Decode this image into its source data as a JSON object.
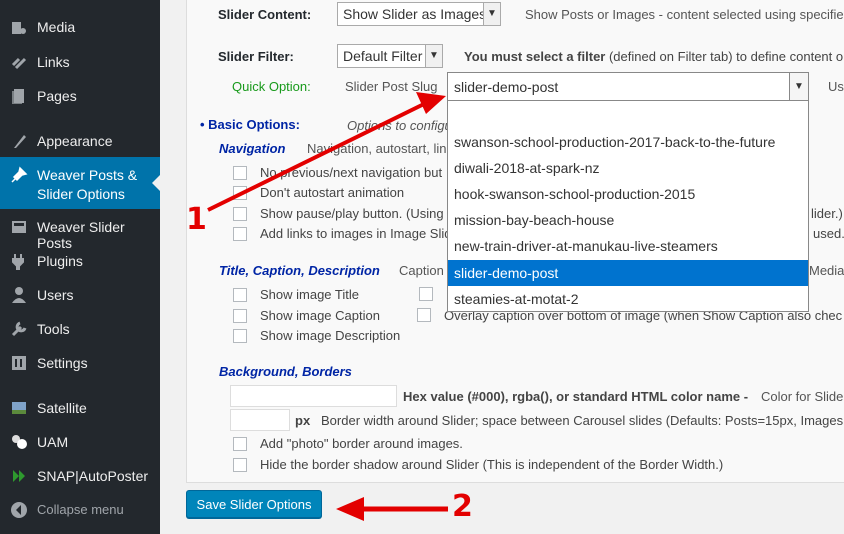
{
  "sidebar": {
    "items": [
      {
        "label": "Media",
        "icon": "media-icon"
      },
      {
        "label": "Links",
        "icon": "links-icon"
      },
      {
        "label": "Pages",
        "icon": "pages-icon"
      },
      {
        "label": "Appearance",
        "icon": "appearance-icon"
      },
      {
        "label": "Weaver Posts & Slider Options",
        "label_line1": "Weaver Posts &",
        "label_line2": "Slider Options",
        "icon": "pin-icon",
        "active": true
      },
      {
        "label": "Weaver Slider Posts",
        "icon": "weaver-slider-posts-icon"
      },
      {
        "label": "Plugins",
        "icon": "plugins-icon"
      },
      {
        "label": "Users",
        "icon": "users-icon"
      },
      {
        "label": "Tools",
        "icon": "tools-icon"
      },
      {
        "label": "Settings",
        "icon": "settings-icon"
      },
      {
        "label": "Satellite",
        "icon": "satellite-icon"
      },
      {
        "label": "UAM",
        "icon": "uam-icon"
      },
      {
        "label": "SNAP|AutoPoster",
        "icon": "snap-icon"
      }
    ],
    "collapse_label": "Collapse menu"
  },
  "form": {
    "slider_content": {
      "label": "Slider Content:",
      "value": "Show Slider as Images",
      "desc": "Show Posts or Images - content selected using specifie"
    },
    "slider_filter": {
      "label": "Slider Filter:",
      "value": "Default Filter",
      "desc_bold": "You must select a filter",
      "desc_rest": " (defined on Filter tab) to define content o"
    },
    "quick_option": {
      "label": "Quick Option:",
      "slug_label": "Slider Post Slug",
      "value": "slider-demo-post",
      "after": "Us"
    },
    "basic_options": {
      "label": "• Basic Options:",
      "desc": "Options to configu"
    },
    "navigation": {
      "header": "Navigation",
      "desc": "Navigation, autostart, lin",
      "options": [
        "No previous/next navigation but",
        "Don't autostart animation",
        "Show pause/play button. (Using",
        "Add links to images in Image Slid"
      ],
      "right_texts": [
        "lider.)",
        "used."
      ]
    },
    "title_caption": {
      "header": "Title, Caption, Description",
      "desc": "Caption",
      "right_text": "Media",
      "options": [
        "Show image Title",
        "Show image Caption",
        "Show image Description"
      ],
      "overlay_text": "Overlay caption over bottom of image (when Show Caption also chec"
    },
    "background": {
      "header": "Background, Borders",
      "hex_label": "Hex value (#000), rgba(), or standard HTML color name -",
      "hex_desc": "Color for Slide",
      "px_label": "px",
      "border_desc": "Border width around Slider; space between Carousel slides (Defaults: Posts=15px, Images",
      "photo_border": "Add \"photo\" border around images.",
      "hide_shadow": "Hide the border shadow around Slider (This is independent of the Border Width.)"
    },
    "save_label": "Save Slider Options"
  },
  "dropdown": {
    "selected": "slider-demo-post",
    "options": [
      "swanson-school-production-2017-back-to-the-future",
      "diwali-2018-at-spark-nz",
      "hook-swanson-school-production-2015",
      "mission-bay-beach-house",
      "new-train-driver-at-manukau-live-steamers",
      "slider-demo-post",
      "steamies-at-motat-2"
    ],
    "highlighted": "slider-demo-post"
  },
  "annotations": {
    "one": "1",
    "two": "2",
    "color": "#e30000"
  },
  "colors": {
    "sidebar_bg": "#23282d",
    "active_bg": "#0073aa",
    "button_bg": "#0085ba",
    "header_blue": "#0025a5",
    "quick_green": "#189a1b"
  }
}
